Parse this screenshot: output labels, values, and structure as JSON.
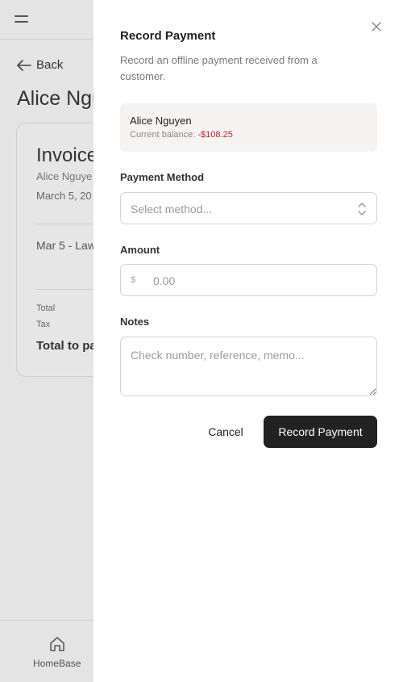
{
  "background": {
    "back_label": "Back",
    "customer_title": "Alice Ngu",
    "invoice": {
      "title": "Invoice",
      "customer": "Alice Nguye",
      "date": "March 5, 20",
      "line_item": "Mar 5 - Law",
      "total_label": "Total",
      "tax_label": "Tax",
      "total_to_pay_label": "Total to pa"
    },
    "bottom_nav": {
      "home_label": "HomeBase"
    }
  },
  "drawer": {
    "title": "Record Payment",
    "description": "Record an offline payment received from a customer.",
    "customer": {
      "name": "Alice Nguyen",
      "balance_label": "Current balance:",
      "balance_value": "-$108.25"
    },
    "payment_method": {
      "label": "Payment Method",
      "placeholder": "Select method..."
    },
    "amount": {
      "label": "Amount",
      "currency": "$",
      "placeholder": "0.00"
    },
    "notes": {
      "label": "Notes",
      "placeholder": "Check number, reference, memo..."
    },
    "cancel_label": "Cancel",
    "submit_label": "Record Payment"
  },
  "colors": {
    "accent": "#222222",
    "negative": "#d21b2a",
    "overlay_bg": "#e4e4e4"
  }
}
